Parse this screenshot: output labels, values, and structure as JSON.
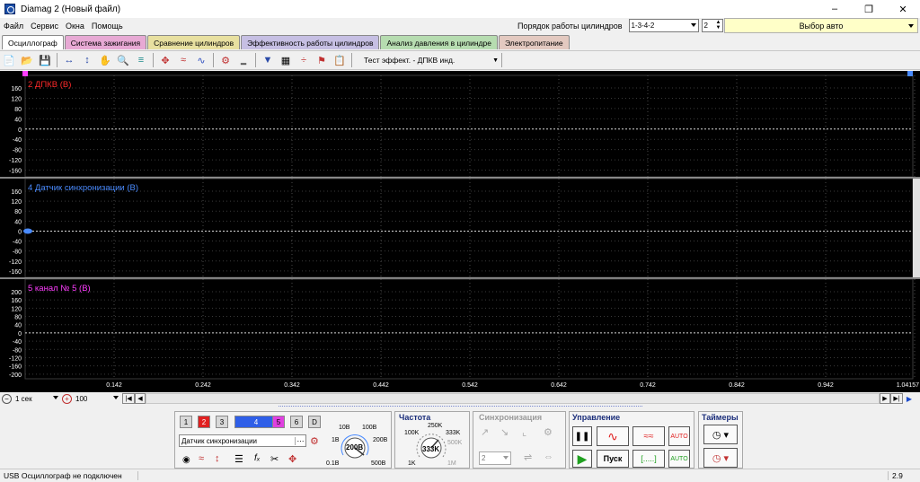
{
  "window": {
    "title": "Diamag 2 (Новый файл)"
  },
  "menu": [
    "Файл",
    "Сервис",
    "Окна",
    "Помощь"
  ],
  "cylinders": {
    "label": "Порядок работы цилиндров",
    "order": "1-3-4-2",
    "count": "2"
  },
  "auto_select": "Выбор авто",
  "tabs": [
    {
      "label": "Осциллограф",
      "color": "#ffffff"
    },
    {
      "label": "Система зажигания",
      "color": "#e7a9d4"
    },
    {
      "label": "Сравнение цилиндров",
      "color": "#e8e0a0"
    },
    {
      "label": "Эффективность работы цилиндров",
      "color": "#c6bfe3"
    },
    {
      "label": "Анализ давления в цилиндре",
      "color": "#b6dcb0"
    },
    {
      "label": "Электропитание",
      "color": "#e3c9c0"
    }
  ],
  "toolbar": {
    "mode_label": "Тест эффект. -  ДПКВ инд."
  },
  "channels": [
    {
      "label": "2 ДПКВ (В)",
      "color": "#ff2a2a",
      "ticks": [
        "160",
        "120",
        "80",
        "40",
        "0",
        "-40",
        "-80",
        "-120",
        "-160"
      ]
    },
    {
      "label": "4 Датчик синхронизации (В)",
      "color": "#4a8bff",
      "ticks": [
        "160",
        "120",
        "80",
        "40",
        "0",
        "-40",
        "-80",
        "-120",
        "-160"
      ]
    },
    {
      "label": "5 канал № 5 (В)",
      "color": "#ff3dff",
      "ticks": [
        "200",
        "160",
        "120",
        "80",
        "40",
        "0",
        "-40",
        "-80",
        "-120",
        "-160",
        "-200"
      ]
    }
  ],
  "time_ticks": [
    "0.142",
    "0.242",
    "0.342",
    "0.442",
    "0.542",
    "0.642",
    "0.742",
    "0.842",
    "0.942",
    "1.04157"
  ],
  "timebase": {
    "time": "1 сек",
    "scale": "100"
  },
  "channel_buttons": [
    "1",
    "2",
    "3",
    "4",
    "5",
    "6",
    "D"
  ],
  "channel_select": "Датчик синхронизации",
  "voltage": {
    "current": "200В",
    "labels": [
      "10В",
      "100В",
      "1В",
      "200В",
      "0.1В",
      "500В"
    ]
  },
  "frequency": {
    "title": "Частота",
    "current": "333K",
    "labels": [
      "250K",
      "100K",
      "333K",
      "500K",
      "1K",
      "1M"
    ]
  },
  "sync": {
    "title": "Синхронизация",
    "value": "2"
  },
  "control": {
    "title": "Управление",
    "start": "Пуск",
    "range": "[.....]"
  },
  "timers": {
    "title": "Таймеры"
  },
  "status": {
    "message": "USB Осциллограф не подключен",
    "version": "2.9"
  }
}
